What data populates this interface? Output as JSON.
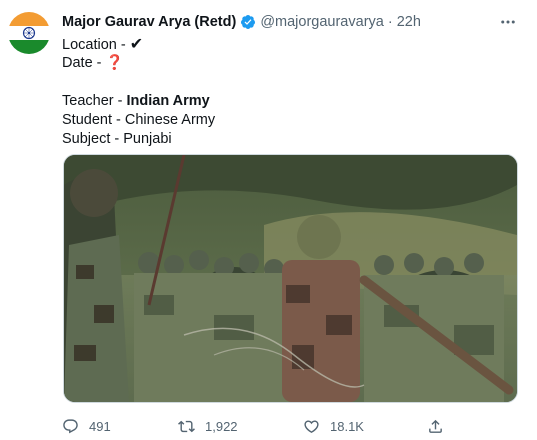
{
  "tweet": {
    "author_name": "Major Gaurav Arya (Retd)",
    "handle": "@majorgauravarya",
    "separator": "·",
    "time": "22h",
    "lines": {
      "location_label": "Location - ",
      "location_emoji": "✔",
      "date_label": "Date - ",
      "date_emoji": "❓",
      "teacher_label": "Teacher - ",
      "teacher_value": "Indian Army",
      "student": "Student - Chinese Army",
      "subject": "Punjabi"
    },
    "subject_label": "Subject - "
  },
  "actions": {
    "replies": "491",
    "retweets": "1,922",
    "likes": "18.1K"
  },
  "colors": {
    "verified": "#1d9bf0",
    "secondary_text": "#536471",
    "date_emoji": "#e0245e",
    "flag_saffron": "#f39c33",
    "flag_green": "#1a8a2c",
    "chakra": "#1f3b8f"
  },
  "icons": {
    "verified": "verified-badge-icon",
    "more": "more-options-icon",
    "reply": "reply-icon",
    "retweet": "retweet-icon",
    "like": "like-icon",
    "share": "share-icon"
  }
}
